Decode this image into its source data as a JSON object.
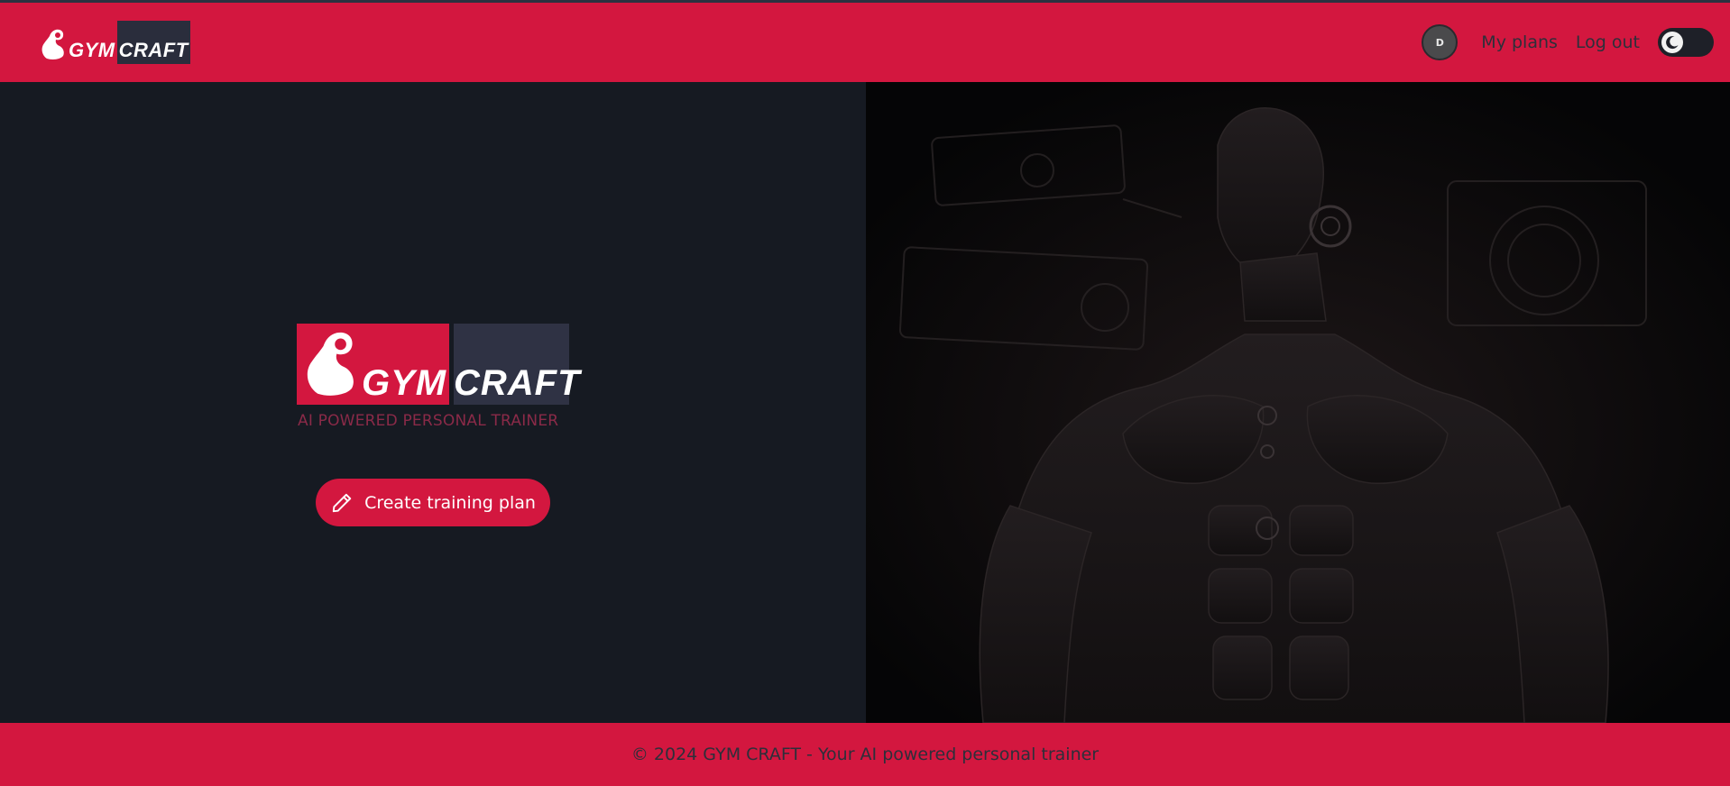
{
  "header": {
    "logo": {
      "word1": "GYM",
      "word2": "CRAFT"
    },
    "avatar_initial": "D",
    "nav": {
      "my_plans": "My plans",
      "logout": "Log out"
    }
  },
  "hero": {
    "logo": {
      "word1": "GYM",
      "word2": "CRAFT"
    },
    "tagline": "AI POWERED PERSONAL TRAINER",
    "cta_label": "Create training plan",
    "cta_icon": "pencil-icon"
  },
  "footer": {
    "text": "© 2024 GYM CRAFT - Your AI powered personal trainer"
  },
  "theme": {
    "accent": "#d3173f",
    "dark_bg": "#161a22",
    "logo_dark": "#2f3244"
  },
  "image": {
    "subject": "cyborg-bodybuilder-illustration"
  }
}
